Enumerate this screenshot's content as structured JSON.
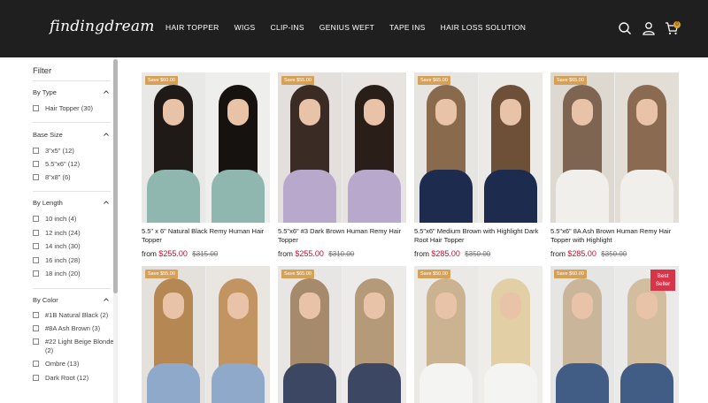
{
  "brand": {
    "logo_text": "findingdream"
  },
  "nav": {
    "items": [
      "HAIR TOPPER",
      "WIGS",
      "CLIP-INS",
      "GENIUS WEFT",
      "TAPE INS",
      "HAIR LOSS SOLUTION"
    ],
    "cart_count": "0"
  },
  "colors": {
    "header_bg": "#1f1f1f",
    "price_red": "#c8102e",
    "save_badge": "#d4a15a",
    "best_badge": "#d8354a"
  },
  "filter": {
    "title": "Filter",
    "groups": [
      {
        "title": "By Type",
        "options": [
          "Hair Topper (30)"
        ]
      },
      {
        "title": "Base Size",
        "options": [
          "3\"x5\" (12)",
          "5.5\"x6\" (12)",
          "8\"x8\" (6)"
        ]
      },
      {
        "title": "By Length",
        "options": [
          "10 inch (4)",
          "12 inch (24)",
          "14 inch (30)",
          "16 inch (28)",
          "18 inch (20)"
        ]
      },
      {
        "title": "By Color",
        "options": [
          "#1B Natural Black (2)",
          "#8A Ash Brown (3)",
          "#22 Light Beige Blonde (2)",
          "Ombre (13)",
          "Dark Root (12)"
        ]
      }
    ]
  },
  "products": [
    {
      "badge": "Save $60.00",
      "name": "5.5\" x 6\" Natural Black Remy Human Hair Topper",
      "from": "from",
      "price": "$255.00",
      "old_price": "$315.00"
    },
    {
      "badge": "Save $55.00",
      "name": "5.5\"x6\" #3 Dark Brown Human Remy Hair Topper",
      "from": "from",
      "price": "$255.00",
      "old_price": "$310.00"
    },
    {
      "badge": "Save $65.00",
      "name": "5.5\"x6\" Medium Brown with Highlight Dark Root Hair Topper",
      "from": "from",
      "price": "$285.00",
      "old_price": "$350.00"
    },
    {
      "badge": "Save $65.00",
      "name": "5.5\"x6\" 8A Ash Brown Human Remy Hair Topper with Highlight",
      "from": "from",
      "price": "$285.00",
      "old_price": "$350.00"
    },
    {
      "badge": "Save $55.00"
    },
    {
      "badge": "Save $65.00"
    },
    {
      "badge": "Save $50.00"
    },
    {
      "badge": "Save $60.00",
      "best": "Best Seller"
    }
  ]
}
